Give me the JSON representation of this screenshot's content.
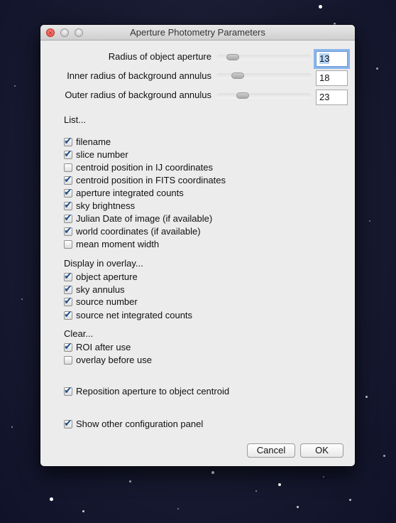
{
  "window": {
    "title": "Aperture Photometry Parameters"
  },
  "fields": [
    {
      "label": "Radius of object aperture",
      "value": "13",
      "slider_fraction": 0.12
    },
    {
      "label": "Inner radius of background annulus",
      "value": "18",
      "slider_fraction": 0.18
    },
    {
      "label": "Outer radius of background annulus",
      "value": "23",
      "slider_fraction": 0.24
    }
  ],
  "sections": {
    "list": "List...",
    "display": "Display in overlay...",
    "clear": "Clear..."
  },
  "list_options": [
    {
      "label": "filename",
      "checked": true
    },
    {
      "label": "slice number",
      "checked": true
    },
    {
      "label": "centroid position in IJ coordinates",
      "checked": false
    },
    {
      "label": "centroid position in FITS coordinates",
      "checked": true
    },
    {
      "label": "aperture integrated counts",
      "checked": true
    },
    {
      "label": "sky brightness",
      "checked": true
    },
    {
      "label": "Julian Date of image (if available)",
      "checked": true
    },
    {
      "label": "world coordinates (if available)",
      "checked": true
    },
    {
      "label": "mean moment width",
      "checked": false
    }
  ],
  "display_options": [
    {
      "label": "object aperture",
      "checked": true
    },
    {
      "label": "sky annulus",
      "checked": true
    },
    {
      "label": "source number",
      "checked": true
    },
    {
      "label": "source net integrated counts",
      "checked": true
    }
  ],
  "clear_options": [
    {
      "label": "ROI after use",
      "checked": true
    },
    {
      "label": "overlay before use",
      "checked": false
    }
  ],
  "extra_options": [
    {
      "label": "Reposition aperture to object centroid",
      "checked": true
    },
    {
      "label": "Show other configuration panel",
      "checked": true
    }
  ],
  "buttons": {
    "cancel": "Cancel",
    "ok": "OK"
  }
}
